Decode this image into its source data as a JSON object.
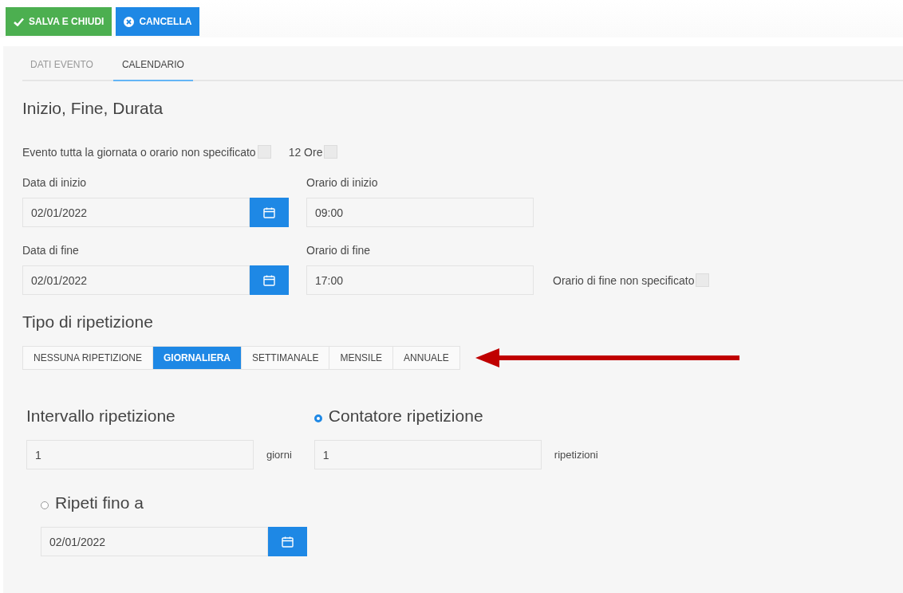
{
  "toolbar": [
    {
      "kind": "save",
      "label": "SALVA E CHIUDI"
    },
    {
      "kind": "cancel",
      "label": "CANCELLA"
    }
  ],
  "tabs": [
    {
      "label": "DATI EVENTO",
      "selected": false
    },
    {
      "label": "CALENDARIO",
      "selected": true
    }
  ],
  "timing": {
    "heading": "Inizio, Fine, Durata",
    "options": [
      {
        "label": "Evento tutta la giornata o orario non specificato",
        "checked": false
      },
      {
        "label": "12 Ore",
        "checked": false
      }
    ],
    "rows": [
      {
        "date_label": "Data di inizio",
        "date": "02/01/2022",
        "time_label": "Orario di inizio",
        "time": "09:00"
      },
      {
        "date_label": "Data di fine",
        "date": "02/01/2022",
        "time_label": "Orario di fine",
        "time": "17:00",
        "option": {
          "label": "Orario di fine non specificato",
          "checked": false
        }
      }
    ]
  },
  "repeat": {
    "heading": "Tipo di ripetizione",
    "types": [
      {
        "label": "NESSUNA RIPETIZIONE",
        "selected": false
      },
      {
        "label": "GIORNALIERA",
        "selected": true
      },
      {
        "label": "SETTIMANALE",
        "selected": false
      },
      {
        "label": "MENSILE",
        "selected": false
      },
      {
        "label": "ANNUALE",
        "selected": false
      }
    ],
    "interval": {
      "label": "Intervallo ripetizione",
      "value": "1",
      "unit": "giorni"
    },
    "counter": {
      "label": "Contatore ripetizione",
      "selected": true,
      "value": "1",
      "unit": "ripetizioni"
    },
    "until": {
      "label": "Ripeti fino a",
      "selected": false,
      "date": "02/01/2022"
    }
  }
}
